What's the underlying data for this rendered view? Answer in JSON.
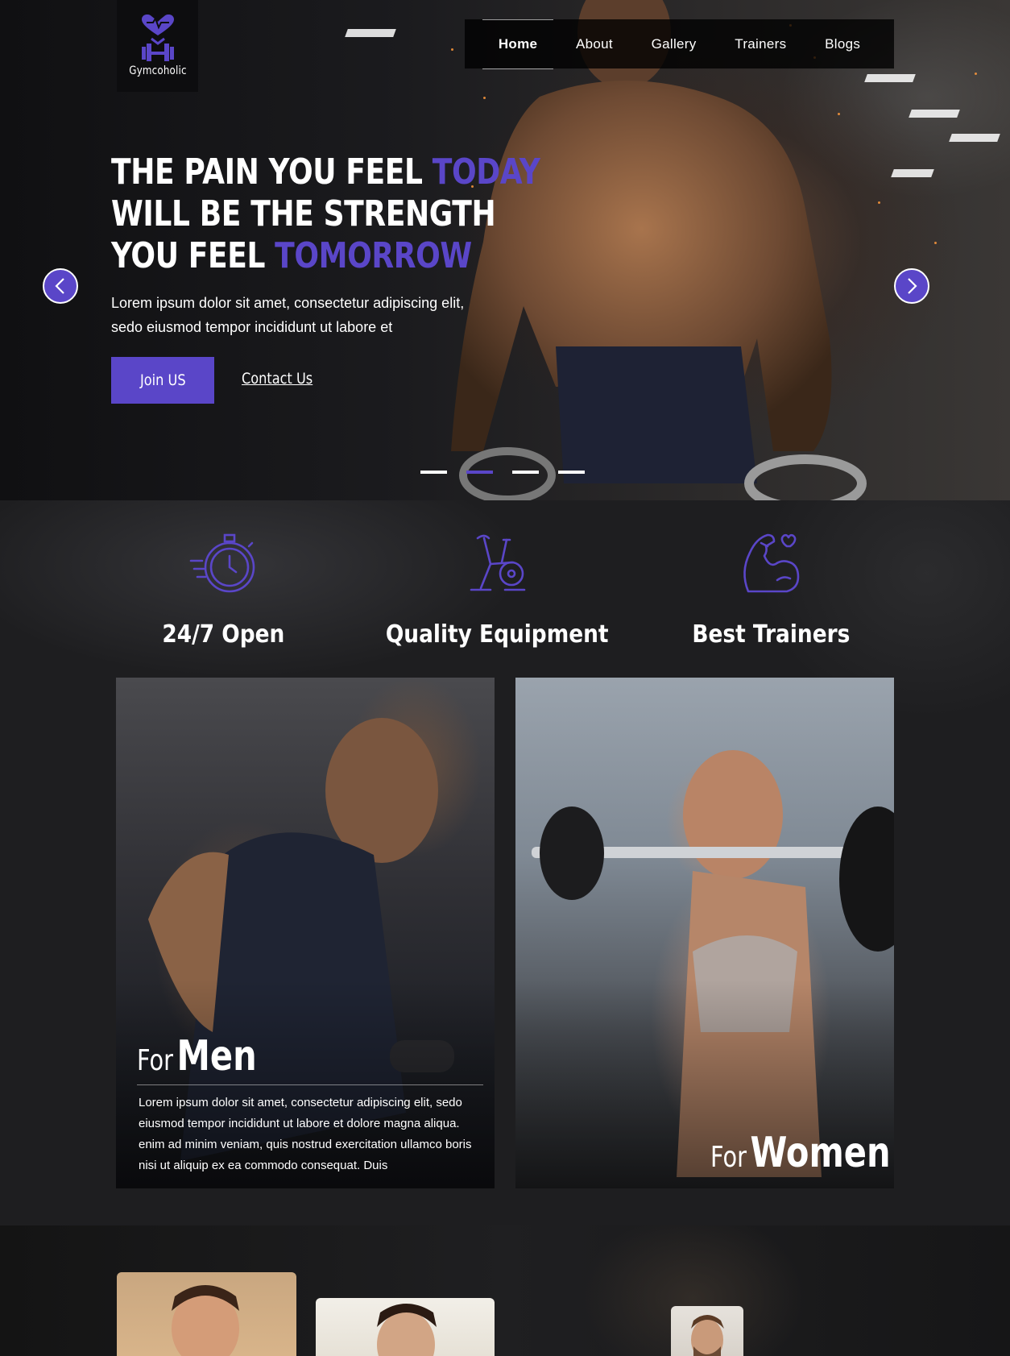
{
  "brand": {
    "name": "Gymcoholic",
    "accent": "#5a46c8"
  },
  "nav": {
    "items": [
      {
        "label": "Home",
        "active": true
      },
      {
        "label": "About",
        "active": false
      },
      {
        "label": "Gallery",
        "active": false
      },
      {
        "label": "Trainers",
        "active": false
      },
      {
        "label": "Blogs",
        "active": false
      }
    ]
  },
  "hero": {
    "line1_start": "THE PAIN YOU FEEL ",
    "line1_accent": "TODAY",
    "line2": "WILL BE THE STRENGTH",
    "line3_start": "YOU FEEL ",
    "line3_accent": "TOMORROW",
    "description": "Lorem ipsum dolor sit amet, consectetur adipiscing elit, sedo eiusmod tempor incididunt ut labore et",
    "primary_button": "Join US",
    "secondary_link": "Contact Us",
    "prev_icon": "chevron-left-icon",
    "next_icon": "chevron-right-icon",
    "slides_total": 4,
    "active_slide": 2
  },
  "features": [
    {
      "title": "24/7 Open",
      "icon": "stopwatch-icon"
    },
    {
      "title": "Quality Equipment",
      "icon": "exercise-bike-icon"
    },
    {
      "title": "Best Trainers",
      "icon": "flexed-arm-heart-icon"
    }
  ],
  "programs": {
    "men": {
      "prefix": "For",
      "title": "Men",
      "description": "Lorem ipsum dolor sit amet, consectetur adipiscing elit, sedo eiusmod tempor incididunt ut labore et dolore magna aliqua.  enim ad minim veniam, quis nostrud exercitation ullamco boris nisi ut aliquip ex ea commodo consequat. Duis"
    },
    "women": {
      "prefix": "For",
      "title": "Women"
    }
  }
}
